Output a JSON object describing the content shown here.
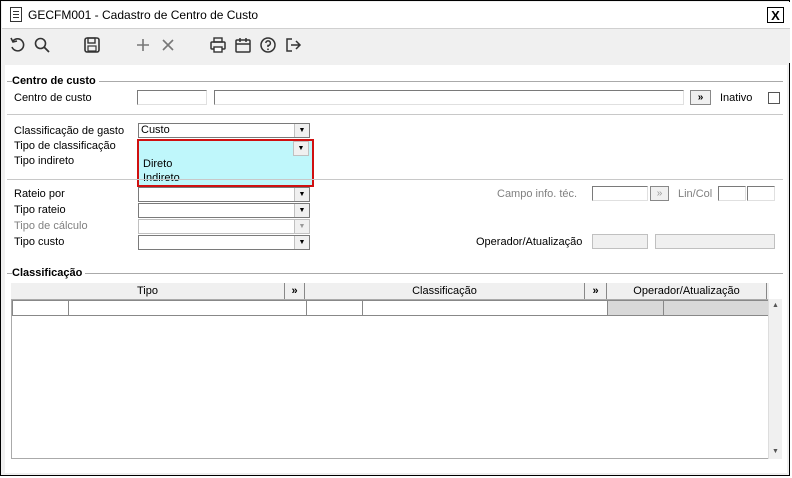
{
  "window": {
    "title": "GECFM001 - Cadastro de Centro de Custo",
    "close_label": "X"
  },
  "toolbar": {
    "icons": [
      "undo-icon",
      "search-icon",
      "save-icon",
      "add-icon",
      "delete-icon",
      "print-icon",
      "calendar-icon",
      "help-icon",
      "exit-icon"
    ]
  },
  "group1": {
    "title": "Centro de custo",
    "centro_label": "Centro de custo",
    "centro_code": "",
    "centro_desc": "",
    "more_button": "»",
    "inativo_label": "Inativo"
  },
  "classif": {
    "gasto_label": "Classificação de gasto",
    "gasto_value": "Custo",
    "tipo_classif_label": "Tipo de classificação",
    "tipo_classif_value": "",
    "tipo_indireto_label": "Tipo indireto",
    "options": [
      "Direto",
      "Indireto"
    ]
  },
  "rateio": {
    "rateio_por_label": "Rateio por",
    "tipo_rateio_label": "Tipo rateio",
    "tipo_calculo_label": "Tipo de cálculo",
    "tipo_custo_label": "Tipo custo",
    "campo_info_label": "Campo info. téc.",
    "campo_btn": "»",
    "lincol_label": "Lin/Col",
    "operador_label": "Operador/Atualização"
  },
  "group2": {
    "title": "Classificação",
    "columns": [
      "Tipo",
      "»",
      "Classificação",
      "»",
      "Operador/Atualização"
    ]
  },
  "colors": {
    "highlight": "#bff7fb",
    "annotation_border": "#d01010"
  }
}
